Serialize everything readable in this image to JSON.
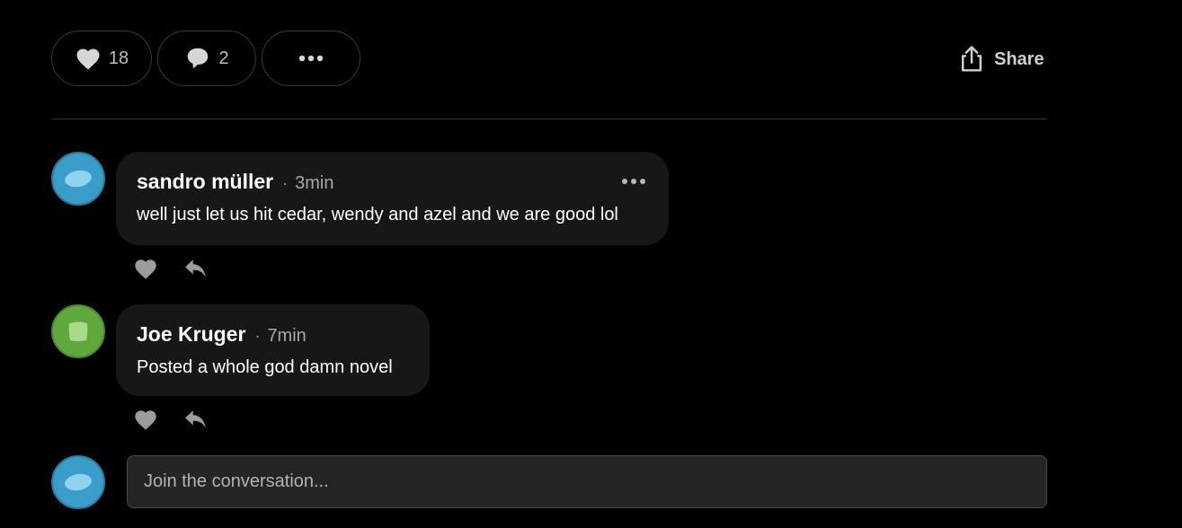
{
  "actions": {
    "likes_count": "18",
    "comments_count": "2",
    "share_label": "Share"
  },
  "comments": [
    {
      "author": "sandro müller",
      "time": "3min",
      "text": "well just let us hit cedar, wendy and azel and we are good lol",
      "avatar_color": "#3a9cc9"
    },
    {
      "author": "Joe Kruger",
      "time": "7min",
      "text": "Posted a whole god damn novel",
      "avatar_color": "#5ea83c"
    }
  ],
  "composer": {
    "placeholder": "Join the conversation..."
  },
  "icons": [
    "heart-icon",
    "comment-icon",
    "more-icon",
    "share-icon",
    "reply-icon"
  ]
}
